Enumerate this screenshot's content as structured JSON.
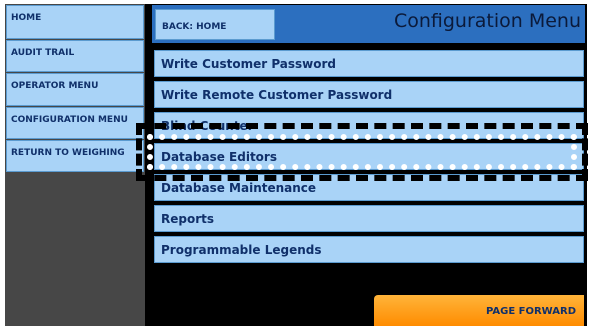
{
  "sidebar": {
    "items": [
      {
        "label": "HOME"
      },
      {
        "label": "AUDIT TRAIL"
      },
      {
        "label": "OPERATOR MENU"
      },
      {
        "label": "CONFIGURATION MENU"
      },
      {
        "label": "RETURN TO WEIGHING"
      }
    ]
  },
  "header": {
    "back_label": "BACK: HOME",
    "title": "Configuration Menu"
  },
  "menu": {
    "items": [
      {
        "label": "Write Customer Password"
      },
      {
        "label": "Write Remote Customer Password"
      },
      {
        "label": "Blind Counter"
      },
      {
        "label": "Database Editors"
      },
      {
        "label": "Database Maintenance"
      },
      {
        "label": "Reports"
      },
      {
        "label": "Programmable Legends"
      }
    ]
  },
  "footer": {
    "page_forward_label": "PAGE FORWARD"
  },
  "colors": {
    "button_bg": "#a9d3f7",
    "header_bg": "#2c6fbf",
    "page_forward_bg": "#ff9a14",
    "sidebar_bg": "#474747"
  }
}
